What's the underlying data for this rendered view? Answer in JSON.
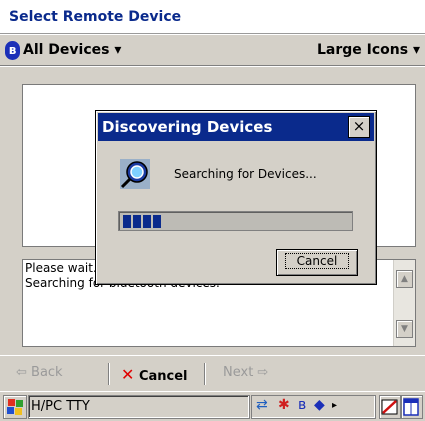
{
  "window": {
    "title": "Select Remote Device"
  },
  "filterbar": {
    "bluetooth_icon": "bluetooth-icon",
    "left_label": "All Devices ▾",
    "right_label": "Large Icons ▾"
  },
  "status": {
    "lines": [
      "Please wait...",
      "Searching for bluetooth devices."
    ]
  },
  "dialog": {
    "title": "Discovering Devices",
    "close_label": "×",
    "message": "Searching for Devices...",
    "progress": 0.2,
    "progress_segments": 4,
    "cancel_label": "Cancel"
  },
  "nav": {
    "back_label": "⇦ Back",
    "cancel_label": "Cancel",
    "next_label": "Next ⇨"
  },
  "taskbar": {
    "task_label": "H/PC TTY"
  },
  "colors": {
    "title_blue": "#0a2a8c",
    "face": "#d4d0c8",
    "cancel_red": "#e00000"
  }
}
